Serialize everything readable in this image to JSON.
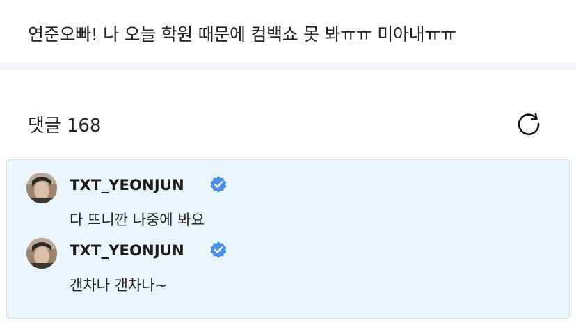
{
  "post": {
    "text": "연준오빠! 나 오늘 학원 때문에 컴백쇼 못 봐ㅠㅠ 미아내ㅠㅠ"
  },
  "comments": {
    "label": "댓글",
    "count": "168",
    "refresh_icon": "refresh-icon"
  },
  "replies": [
    {
      "author": "TXT_YEONJUN",
      "verified": true,
      "text": "다 뜨니깐 나중에 봐요"
    },
    {
      "author": "TXT_YEONJUN",
      "verified": true,
      "text": "갠차나 갠차나~"
    }
  ],
  "colors": {
    "pinned_bg": "#eaf4fb",
    "pinned_border": "#c9e2f2",
    "verified_blue": "#4a90e2",
    "divider": "#f3f4f8"
  }
}
